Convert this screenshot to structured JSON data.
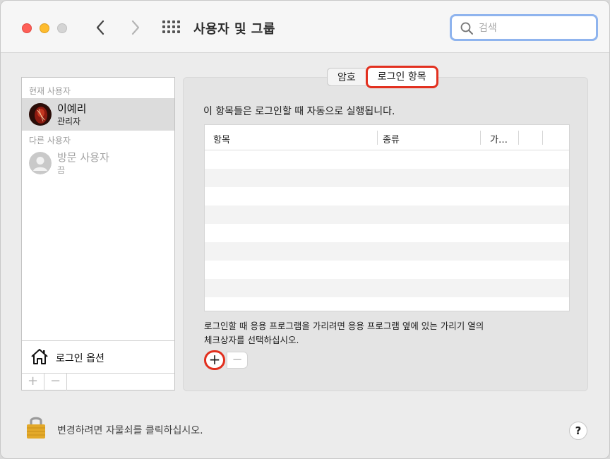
{
  "window": {
    "title": "사용자 및 그룹"
  },
  "search": {
    "placeholder": "검색"
  },
  "sidebar": {
    "current_users_label": "현재 사용자",
    "other_users_label": "다른 사용자",
    "users": [
      {
        "name": "이예리",
        "role": "관리자"
      },
      {
        "name": "방문 사용자",
        "role": "끔"
      }
    ],
    "login_options_label": "로그인 옵션",
    "add_label": "+",
    "remove_label": "−"
  },
  "tabs": [
    {
      "label": "암호"
    },
    {
      "label": "로그인 항목"
    }
  ],
  "login_items": {
    "description": "이 항목들은 로그인할 때 자동으로 실행됩니다.",
    "columns": [
      "항목",
      "종류",
      "가…"
    ],
    "hint_line1": "로그인할 때 응용 프로그램을 가리려면 응용 프로그램 옆에 있는 가리기 열의",
    "hint_line2": "체크상자를 선택하십시오.",
    "add_label": "+",
    "remove_label": "−"
  },
  "footer": {
    "lock_text": "변경하려면 자물쇠를 클릭하십시오.",
    "help_label": "?"
  },
  "colors": {
    "highlight_red": "#e2301f",
    "search_focus": "#8fb4ee"
  }
}
